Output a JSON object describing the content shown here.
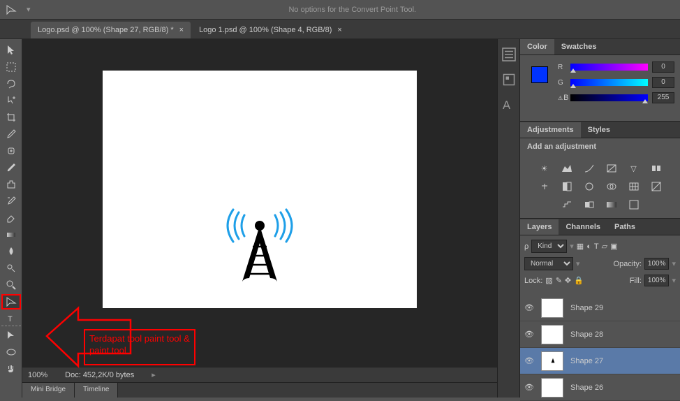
{
  "topbar": {
    "message": "No options for the Convert Point Tool."
  },
  "tabs": [
    {
      "label": "Logo.psd @ 100% (Shape 27, RGB/8) *",
      "active": true
    },
    {
      "label": "Logo 1.psd @ 100% (Shape 4, RGB/8)",
      "active": false
    }
  ],
  "tools": [
    "move",
    "marquee-rect",
    "marquee-ellipse",
    "lasso",
    "quick-select",
    "crop",
    "eyedropper",
    "healing",
    "brush",
    "clone",
    "history-brush",
    "eraser",
    "gradient",
    "blur",
    "dodge",
    "pen",
    "convert-point",
    "type",
    "path-select",
    "shape",
    "hand",
    "zoom"
  ],
  "annotation": {
    "text": "Terdapat tool paint tool & paint tool"
  },
  "status": {
    "zoom": "100%",
    "docinfo": "Doc: 452,2K/0 bytes"
  },
  "bottom_tabs": [
    "Mini Bridge",
    "Timeline"
  ],
  "color": {
    "tabs": [
      "Color",
      "Swatches"
    ],
    "r": {
      "label": "R",
      "value": "0"
    },
    "g": {
      "label": "G",
      "value": "0"
    },
    "b": {
      "label": "B",
      "value": "255"
    },
    "fg": "#0033ff"
  },
  "adjustments": {
    "tabs": [
      "Adjustments",
      "Styles"
    ],
    "title": "Add an adjustment"
  },
  "layers": {
    "tabs": [
      "Layers",
      "Channels",
      "Paths"
    ],
    "kind": "Kind",
    "blend": "Normal",
    "opacity_label": "Opacity:",
    "opacity": "100%",
    "lock_label": "Lock:",
    "fill_label": "Fill:",
    "fill": "100%",
    "items": [
      {
        "name": "Shape 29",
        "selected": false
      },
      {
        "name": "Shape 28",
        "selected": false
      },
      {
        "name": "Shape 27",
        "selected": true
      },
      {
        "name": "Shape 26",
        "selected": false
      }
    ]
  }
}
